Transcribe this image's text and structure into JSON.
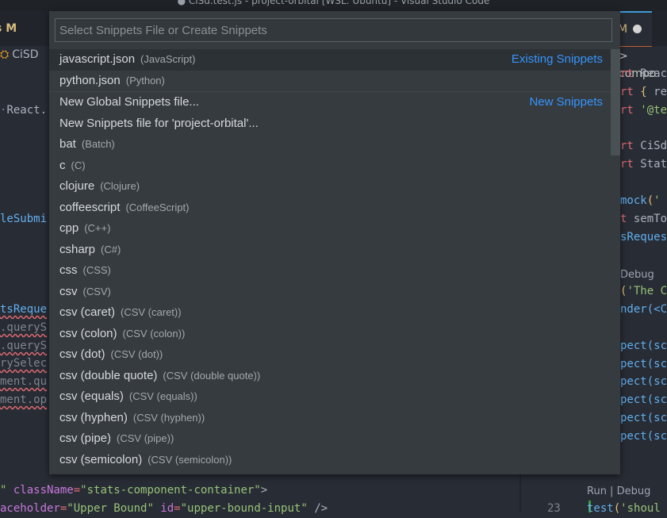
{
  "window": {
    "title": "● CiSd.test.js - project-orbital [WSL: Ubuntu] - Visual Studio Code"
  },
  "editor_left": {
    "tab_label": "s M",
    "breadcrumb": "CiSD",
    "breadcrumb_icon": "symbol-class-icon",
    "lines": [
      {
        "text": "React."
      },
      {
        "text": "leSubmi"
      },
      {
        "text": "tsReque"
      },
      {
        "text": ".queryS"
      },
      {
        "text": ".queryS"
      },
      {
        "text": "rySelec"
      },
      {
        "text": "ment.qu"
      },
      {
        "text": "ment.op"
      }
    ],
    "bottom_lines": [
      {
        "a": "\" ",
        "attr": "className",
        "eq": "=",
        "val": "\"stats-component-container\"",
        "end": ">"
      },
      {
        "a": "aceholder",
        "eq": "=",
        "val": "\"Upper Bound\"",
        "b": " id",
        "eq2": "=",
        "val2": "\"upper-bound-input\"",
        "end": " />"
      }
    ]
  },
  "editor_right": {
    "tab_label": "M",
    "tab_dirty_indicator": "●",
    "breadcrumb": "> compo",
    "lines": [
      {
        "kw": "rt ",
        "rest": "Reac"
      },
      {
        "kw": "rt ",
        "br": "{",
        "rest": " re"
      },
      {
        "kw": "rt ",
        "str": "'@te"
      },
      {
        "kw": "rt ",
        "rest": "CiSd"
      },
      {
        "kw": "rt ",
        "rest": "Stat"
      },
      {
        "rest": "mock",
        "br": "(",
        "str": "'"
      },
      {
        "kw": "t ",
        "rest": "semTo"
      },
      {
        "rest": "sReques"
      },
      {
        "lens": "Debug"
      },
      {
        "br": "(",
        "str": "'The C"
      },
      {
        "rest": "nder(<C"
      },
      {
        "rest": "pect(sc"
      },
      {
        "rest": "pect(sc"
      },
      {
        "rest": "pect(sc"
      },
      {
        "rest": "pect(sc"
      },
      {
        "rest": "pect(sc"
      },
      {
        "rest": "pect(sc"
      }
    ],
    "codelens": "Run | Debug",
    "line_number": "23",
    "last_line": {
      "fn": "test",
      "br": "(",
      "str": "'shoul"
    }
  },
  "quick_pick": {
    "placeholder": "Select Snippets File or Create Snippets",
    "value": "",
    "items": [
      {
        "label": "javascript.json",
        "description": "(JavaScript)",
        "group": "Existing Snippets",
        "active": true
      },
      {
        "label": "python.json",
        "description": "(Python)"
      },
      {
        "label": "New Global Snippets file...",
        "description": "",
        "group": "New Snippets",
        "separator": true
      },
      {
        "label": "New Snippets file for 'project-orbital'...",
        "description": ""
      },
      {
        "label": "bat",
        "description": "(Batch)"
      },
      {
        "label": "c",
        "description": "(C)"
      },
      {
        "label": "clojure",
        "description": "(Clojure)"
      },
      {
        "label": "coffeescript",
        "description": "(CoffeeScript)"
      },
      {
        "label": "cpp",
        "description": "(C++)"
      },
      {
        "label": "csharp",
        "description": "(C#)"
      },
      {
        "label": "css",
        "description": "(CSS)"
      },
      {
        "label": "csv",
        "description": "(CSV)"
      },
      {
        "label": "csv (caret)",
        "description": "(CSV (caret))"
      },
      {
        "label": "csv (colon)",
        "description": "(CSV (colon))"
      },
      {
        "label": "csv (dot)",
        "description": "(CSV (dot))"
      },
      {
        "label": "csv (double quote)",
        "description": "(CSV (double quote))"
      },
      {
        "label": "csv (equals)",
        "description": "(CSV (equals))"
      },
      {
        "label": "csv (hyphen)",
        "description": "(CSV (hyphen))"
      },
      {
        "label": "csv (pipe)",
        "description": "(CSV (pipe))"
      },
      {
        "label": "csv (semicolon)",
        "description": "(CSV (semicolon))"
      }
    ]
  },
  "colors": {
    "accent_link": "#3794ff",
    "active_tab_border": "#3d9bd9",
    "modified_text": "#d7ba7d"
  }
}
